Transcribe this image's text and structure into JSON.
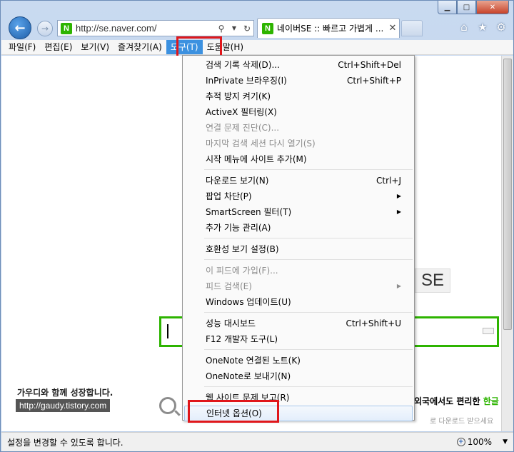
{
  "browser": {
    "url": "http://se.naver.com/",
    "tab_title": "네이버SE :: 빠르고 가볍게 ...",
    "favicon_letter": "N",
    "accent": "#3c91e0",
    "highlight_color": "#e0171b"
  },
  "menubar": [
    {
      "label": "파일(F)"
    },
    {
      "label": "편집(E)"
    },
    {
      "label": "보기(V)"
    },
    {
      "label": "즐겨찾기(A)"
    },
    {
      "label": "도구(T)",
      "active": true
    },
    {
      "label": "도움말(H)"
    }
  ],
  "tools_menu": {
    "items": [
      {
        "label": "검색 기록 삭제(D)...",
        "shortcut": "Ctrl+Shift+Del"
      },
      {
        "label": "InPrivate 브라우징(I)",
        "shortcut": "Ctrl+Shift+P"
      },
      {
        "label": "추적 방지 켜기(K)",
        "shortcut": ""
      },
      {
        "label": "ActiveX 필터링(X)",
        "shortcut": ""
      },
      {
        "label": "연결 문제 진단(C)...",
        "shortcut": "",
        "disabled": true
      },
      {
        "label": "마지막 검색 세션 다시 열기(S)",
        "shortcut": "",
        "disabled": true
      },
      {
        "label": "시작 메뉴에 사이트 추가(M)",
        "shortcut": ""
      },
      {
        "label": "다운로드 보기(N)",
        "shortcut": "Ctrl+J"
      },
      {
        "label": "팝업 차단(P)",
        "shortcut": "",
        "submenu": true
      },
      {
        "label": "SmartScreen 필터(T)",
        "shortcut": "",
        "submenu": true
      },
      {
        "label": "추가 기능 관리(A)",
        "shortcut": ""
      },
      {
        "label": "호환성 보기 설정(B)",
        "shortcut": ""
      },
      {
        "label": "이 피드에 가입(F)...",
        "shortcut": "",
        "disabled": true
      },
      {
        "label": "피드 검색(E)",
        "shortcut": "",
        "disabled": true,
        "submenu": true
      },
      {
        "label": "Windows 업데이트(U)",
        "shortcut": ""
      },
      {
        "label": "성능 대시보드",
        "shortcut": "Ctrl+Shift+U"
      },
      {
        "label": "F12 개발자 도구(L)",
        "shortcut": ""
      },
      {
        "label": "OneNote 연결된 노트(K)",
        "shortcut": ""
      },
      {
        "label": "OneNote로 보내기(N)",
        "shortcut": ""
      },
      {
        "label": "웹 사이트 문제 보고(R)",
        "shortcut": ""
      },
      {
        "label": "인터넷 옵션(O)",
        "shortcut": "",
        "focused": true
      }
    ]
  },
  "page": {
    "se_logo": "SE",
    "ad_text_a": "외국에서도 편리한 ",
    "ad_text_b": "한글",
    "ad_text_sub": "로 다운로드 받으세요",
    "watermark_text": "가우디와 함께 성장합니다.",
    "watermark_url": "http://gaudy.tistory.com"
  },
  "statusbar": {
    "text": "설정을 변경할 수 있도록 합니다.",
    "zoom": "100%"
  }
}
